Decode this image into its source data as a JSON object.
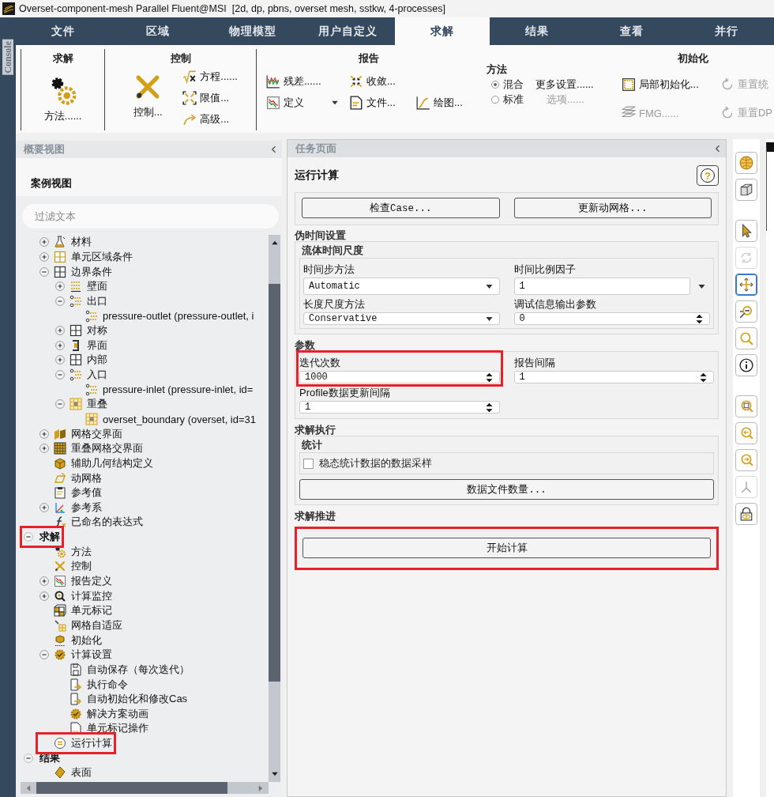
{
  "window": {
    "title": "Overset-component-mesh Parallel Fluent@MSI  [2d, dp, pbns, overset mesh, sstkw, 4-processes]"
  },
  "console_tab": {
    "label": "Console"
  },
  "tabs": [
    {
      "label": "文件",
      "selected": false
    },
    {
      "label": "区域",
      "selected": false
    },
    {
      "label": "物理模型",
      "selected": false
    },
    {
      "label": "用户自定义",
      "selected": false
    },
    {
      "label": "求解",
      "selected": true
    },
    {
      "label": "结果",
      "selected": false
    },
    {
      "label": "查看",
      "selected": false
    },
    {
      "label": "并行",
      "selected": false
    }
  ],
  "ribbon": {
    "groups": [
      {
        "title": "求解",
        "items": [
          {
            "kind": "large",
            "label": "方法......",
            "disabled": false
          }
        ]
      },
      {
        "title": "控制",
        "items": [
          {
            "kind": "large",
            "label": "控制...",
            "disabled": false
          },
          {
            "kind": "small",
            "label": "方程......",
            "disabled": false
          },
          {
            "kind": "small",
            "label": "限值...",
            "disabled": false
          },
          {
            "kind": "small",
            "label": "高级...",
            "disabled": false
          }
        ]
      },
      {
        "title": "报告",
        "items": [
          {
            "kind": "small",
            "label": "残差......",
            "disabled": false
          },
          {
            "kind": "small",
            "label": "收敛...",
            "disabled": false
          },
          {
            "kind": "dropdown",
            "label": "定义",
            "disabled": false
          },
          {
            "kind": "small",
            "label": "文件...",
            "disabled": false
          },
          {
            "kind": "small",
            "label": "绘图...",
            "disabled": false
          }
        ]
      },
      {
        "title": "方法",
        "items": [
          {
            "kind": "radio",
            "label": "混合",
            "selected": true
          },
          {
            "kind": "radio",
            "label": "标准",
            "selected": false
          },
          {
            "kind": "text",
            "label": "更多设置......",
            "disabled": false
          },
          {
            "kind": "text",
            "label": "选项......",
            "disabled": true
          }
        ]
      },
      {
        "title": "初始化",
        "items": [
          {
            "kind": "small",
            "label": "局部初始化...",
            "disabled": false
          },
          {
            "kind": "small",
            "label": "重置统",
            "disabled": true
          },
          {
            "kind": "small",
            "label": "FMG......",
            "disabled": true
          },
          {
            "kind": "small",
            "label": "重置DP",
            "disabled": true
          }
        ]
      }
    ]
  },
  "outline": {
    "header": "概要视图",
    "title": "案例视图",
    "filter": {
      "placeholder": "过滤文本"
    },
    "tree": [
      {
        "expanded": true,
        "children": [
          {
            "label": "材料",
            "expanded": false
          },
          {
            "label": "单元区域条件",
            "expanded": false
          },
          {
            "label": "边界条件",
            "expanded": true,
            "children": [
              {
                "label": "壁面",
                "expanded": false
              },
              {
                "label": "出口",
                "expanded": true,
                "children": [
                  {
                    "label": "pressure-outlet (pressure-outlet, i"
                  }
                ]
              },
              {
                "label": "对称",
                "expanded": false
              },
              {
                "label": "界面",
                "expanded": false
              },
              {
                "label": "内部",
                "expanded": false
              },
              {
                "label": "入口",
                "expanded": true,
                "children": [
                  {
                    "label": "pressure-inlet (pressure-inlet, id="
                  }
                ]
              },
              {
                "label": "重叠",
                "expanded": true,
                "children": [
                  {
                    "label": "overset_boundary (overset, id=31"
                  }
                ]
              }
            ]
          },
          {
            "label": "网格交界面",
            "expanded": false
          },
          {
            "label": "重叠网格交界面",
            "expanded": false
          },
          {
            "label": "辅助几何结构定义"
          },
          {
            "label": "动网格"
          },
          {
            "label": "参考值"
          },
          {
            "label": "参考系",
            "expanded": false
          },
          {
            "label": "已命名的表达式"
          }
        ]
      },
      {
        "label": "求解",
        "expanded": true,
        "highlighted": true,
        "children": [
          {
            "label": "方法"
          },
          {
            "label": "控制"
          },
          {
            "label": "报告定义",
            "expanded": false
          },
          {
            "label": "计算监控",
            "expanded": false
          },
          {
            "label": "单元标记"
          },
          {
            "label": "网格自适应"
          },
          {
            "label": "初始化"
          },
          {
            "label": "计算设置",
            "expanded": true,
            "children": [
              {
                "label": "自动保存（每次迭代）"
              },
              {
                "label": "执行命令"
              },
              {
                "label": "自动初始化和修改Cas"
              },
              {
                "label": "解决方案动画"
              },
              {
                "label": "单元标记操作"
              }
            ]
          },
          {
            "label": "运行计算",
            "highlighted": true
          }
        ]
      },
      {
        "label": "结果",
        "expanded": true,
        "children": [
          {
            "label": "表面"
          }
        ]
      }
    ]
  },
  "task_page": {
    "header": "任务页面",
    "title": "运行计算",
    "help_button": "?",
    "top_buttons": [
      "检查Case...",
      "更新动网格..."
    ],
    "sections": [
      {
        "title": "伪时间设置",
        "subgroup": "流体时间尺度",
        "fields": [
          {
            "label": "时间步方法",
            "kind": "dropdown",
            "value": "Automatic"
          },
          {
            "label": "时间比例因子",
            "kind": "menu_input",
            "value": "1"
          },
          {
            "label": "长度尺度方法",
            "kind": "dropdown",
            "value": "Conservative"
          },
          {
            "label": "调试信息输出参数",
            "kind": "spinner",
            "value": "0"
          }
        ]
      },
      {
        "title": "参数",
        "fields": [
          {
            "label": "迭代次数",
            "kind": "spinner",
            "value": "1000",
            "highlighted": true
          },
          {
            "label": "报告间隔",
            "kind": "spinner",
            "value": "1"
          },
          {
            "label": "Profile数据更新间隔",
            "kind": "spinner",
            "value": "1"
          }
        ]
      },
      {
        "title": "求解执行",
        "subgroup": "统计",
        "checkbox": {
          "label": "稳态统计数据的数据采样",
          "checked": false
        },
        "button": "数据文件数量..."
      },
      {
        "title": "求解推进",
        "button": "开始计算",
        "highlighted": true
      }
    ]
  },
  "view_tools": [
    {
      "selected": false,
      "disabled": false
    },
    {
      "selected": false,
      "disabled": false
    },
    {
      "selected": false,
      "disabled": false
    },
    {
      "selected": false,
      "disabled": true
    },
    {
      "selected": true,
      "disabled": false
    },
    {
      "selected": false,
      "disabled": false
    },
    {
      "selected": false,
      "disabled": false
    },
    {
      "selected": false,
      "disabled": false
    },
    {
      "selected": false,
      "disabled": false
    },
    {
      "selected": false,
      "disabled": false
    },
    {
      "selected": false,
      "disabled": false
    },
    {
      "selected": false,
      "disabled": true
    },
    {
      "selected": false,
      "disabled": false
    }
  ]
}
